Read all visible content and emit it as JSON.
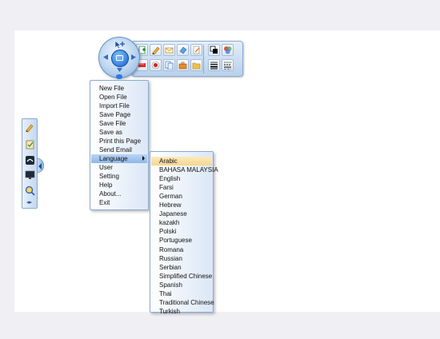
{
  "main_toolbar": {
    "buttons": [
      {
        "icon": "new-page-icon"
      },
      {
        "icon": "pencil-icon"
      },
      {
        "icon": "envelope-icon"
      },
      {
        "icon": "eraser-icon"
      },
      {
        "icon": "note-icon"
      },
      {
        "icon": "fill-color-icon"
      },
      {
        "icon": "shapes-icon"
      },
      {
        "icon": "ruler-icon"
      },
      {
        "icon": "record-icon"
      },
      {
        "icon": "page-copy-icon"
      },
      {
        "icon": "toolbox-icon"
      },
      {
        "icon": "folder-icon"
      },
      {
        "icon": "line-width-icon"
      },
      {
        "icon": "line-style-icon"
      }
    ]
  },
  "side_toolbar": {
    "buttons": [
      {
        "icon": "pencil-icon"
      },
      {
        "icon": "clipboard-icon"
      },
      {
        "icon": "screen-capture-icon"
      },
      {
        "icon": "monitor-icon"
      },
      {
        "icon": "magnifier-icon"
      }
    ],
    "arrows": "◂▸"
  },
  "main_menu": {
    "items": [
      {
        "label": "New File"
      },
      {
        "label": "Open File"
      },
      {
        "label": "Import File"
      },
      {
        "label": "Save Page"
      },
      {
        "label": "Save File"
      },
      {
        "label": "Save as"
      },
      {
        "label": "Print this Page"
      },
      {
        "label": "Send Email"
      },
      {
        "label": "Language",
        "submenu": true
      },
      {
        "label": "User"
      },
      {
        "label": "Setting"
      },
      {
        "label": "Help"
      },
      {
        "label": "About..."
      },
      {
        "label": "Exit"
      }
    ]
  },
  "language_menu": {
    "items": [
      "Arabic",
      "BAHASA MALAYSIA",
      "English",
      "Farsi",
      "German",
      "Hebrew",
      "Japanese",
      "kazakh",
      "Polski",
      "Portuguese",
      "Romana",
      "Russian",
      "Serbian",
      "Simplified Chinese",
      "Spanish",
      "Thai",
      "Traditional Chinese",
      "Turkish"
    ],
    "highlighted": "Arabic"
  }
}
